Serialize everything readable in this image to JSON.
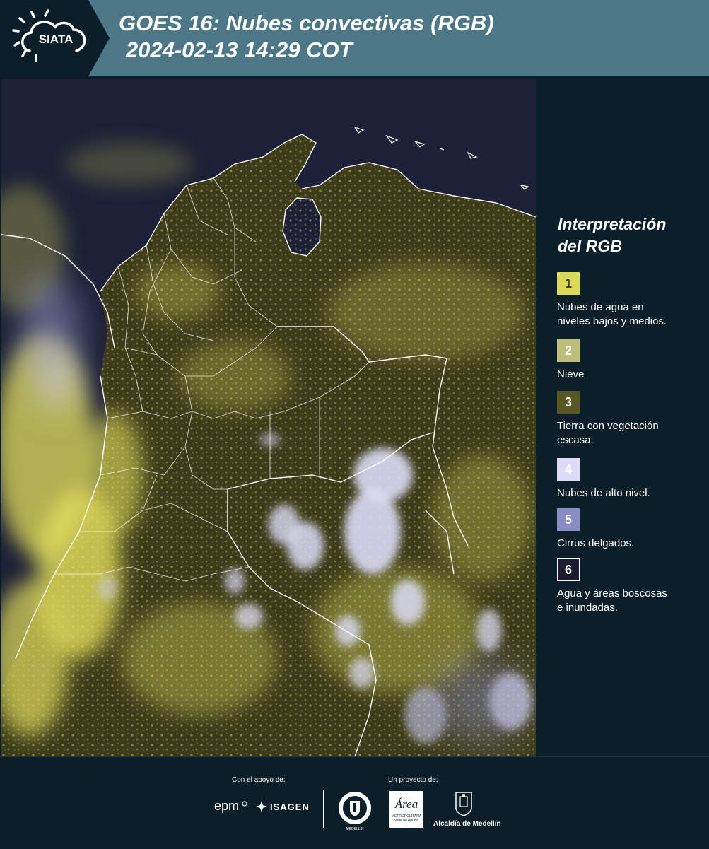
{
  "header": {
    "logo_text": "SIATA",
    "title_line1": "GOES 16: Nubes convectivas (RGB)",
    "title_line2": "2024-02-13 14:29 COT"
  },
  "map": {
    "land_color": "#3c3b1c",
    "water_color": "#1d2036",
    "border_color": "#ffffff",
    "cloud_low_color": "#e3df5c",
    "cloud_high_color": "#d9d9f5"
  },
  "legend": {
    "title_line1": "Interpretación",
    "title_line2": "del RGB",
    "items": [
      {
        "num": "1",
        "color": "#dcd85a",
        "text_color": "#3a3a1a",
        "label_line1": "Nubes de agua en",
        "label_line2": "niveles bajos y medios."
      },
      {
        "num": "2",
        "color": "#bfbd7c",
        "text_color": "#ffffff",
        "label_line1": "Nieve",
        "label_line2": ""
      },
      {
        "num": "3",
        "color": "#575721",
        "text_color": "#ffffff",
        "label_line1": "Tierra con vegetación",
        "label_line2": "escasa."
      },
      {
        "num": "4",
        "color": "#dcdcf6",
        "text_color": "#ffffff",
        "label_line1": "Nubes de alto nivel.",
        "label_line2": ""
      },
      {
        "num": "5",
        "color": "#8a8cc4",
        "text_color": "#ffffff",
        "label_line1": "Cirrus delgados.",
        "label_line2": ""
      },
      {
        "num": "6",
        "color": "#1c1c30",
        "text_color": "#ffffff",
        "label_line1": "Agua y áreas boscosas",
        "label_line2": "e inundadas."
      }
    ]
  },
  "footer": {
    "support_label": "Con el apoyo de:",
    "project_label": "Un proyecto de:",
    "epm_text": "epm",
    "isagen_text": "ISAGEN",
    "area_text": "Área",
    "metro_line1": "METROPOLITANA",
    "metro_line2": "Valle de Aburrá",
    "alcaldia_text": "Alcaldía de Medellín",
    "seal_text": "MEDELLÍN"
  }
}
